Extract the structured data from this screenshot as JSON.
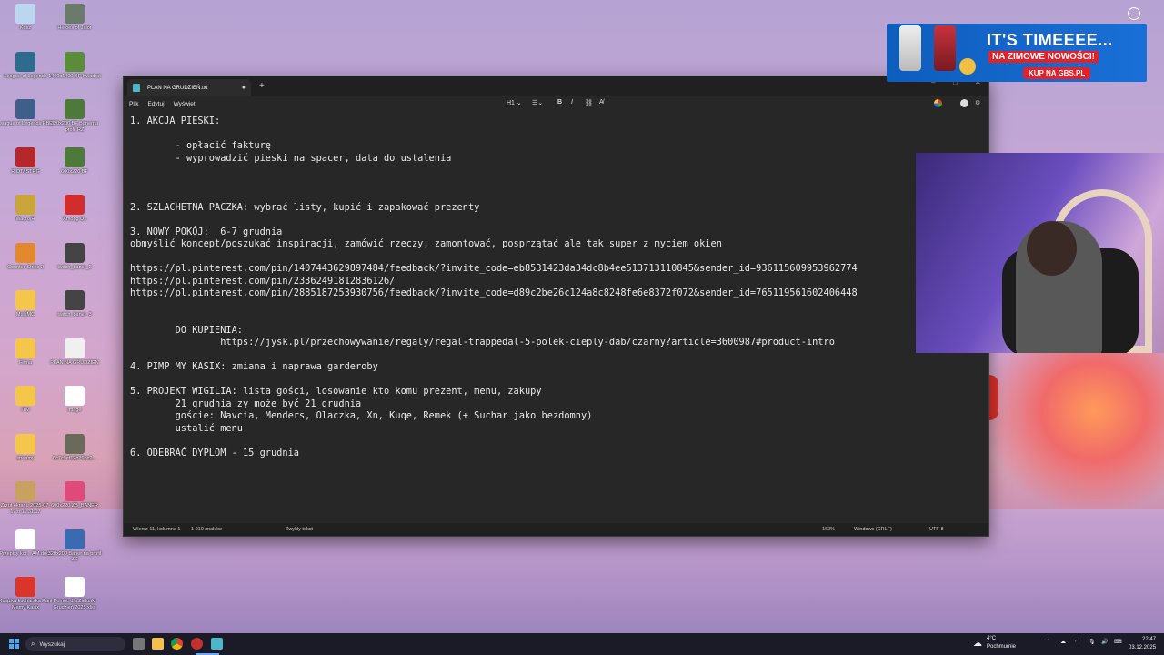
{
  "desktop": {
    "icons": [
      {
        "label": "Kosz",
        "color": "#bcd6f0"
      },
      {
        "label": "Heroes of Jalor",
        "color": "#6b7a6b"
      },
      {
        "label": "League of Legends",
        "color": "#2d6b8f"
      },
      {
        "label": "1400x1400 BF Kwadrat",
        "color": "#5a8c3a"
      },
      {
        "label": "League of Legends PBE",
        "color": "#3d5f8a"
      },
      {
        "label": "320x200 BF Banerna profil RZ",
        "color": "#4d7a3a"
      },
      {
        "label": "RIOT/ISTRG",
        "color": "#b5272a"
      },
      {
        "label": "600x220 BF",
        "color": "#4d7a3a"
      },
      {
        "label": "Macro/H",
        "color": "#c9a53a"
      },
      {
        "label": "Among Us",
        "color": "#d22d2d"
      },
      {
        "label": "Counter-Strike 2",
        "color": "#e3892b"
      },
      {
        "label": "twitch_baner_2",
        "color": "#444"
      },
      {
        "label": "MultiMC",
        "color": "#f4c74a"
      },
      {
        "label": "twitch_baner_3",
        "color": "#444"
      },
      {
        "label": "Firma",
        "color": "#f4c74a"
      },
      {
        "label": "PLAN NA GRUDZIEŃ",
        "color": "#f0f0f0"
      },
      {
        "label": "ITM",
        "color": "#f4c74a"
      },
      {
        "label": "image",
        "color": "#ffffff"
      },
      {
        "label": "streamy",
        "color": "#f4c74a"
      },
      {
        "label": "6c7c9ef12b79bc2...",
        "color": "#6a6a5a"
      },
      {
        "label": "Zrzut ekranu 2025-07-17 o 11.31.17",
        "color": "#c8a060"
      },
      {
        "label": "600x220 ZB_BANER",
        "color": "#e04a7a"
      },
      {
        "label": "Przepisy kor... AM.docx",
        "color": "#ffffff"
      },
      {
        "label": "320x200 Baner na profil ZS",
        "color": "#3a6ab0"
      },
      {
        "label": "Książka kucharska Pani Mamy Kasix",
        "color": "#d9352b"
      },
      {
        "label": "Pomoc dla Zielonki Grudzień 2025.xlsx",
        "color": "#ffffff"
      }
    ]
  },
  "notepad": {
    "tab_title": "PLAN NA GRUDZIEŃ.txt",
    "menu": [
      "Plik",
      "Edytuj",
      "Wyświetl"
    ],
    "heading_select": "H1",
    "lines": [
      "1. AKCJA PIESKI:",
      "",
      "        - opłacić fakturę",
      "        - wyprowadzić pieski na spacer, data do ustalenia",
      "",
      "",
      "",
      "2. SZLACHETNA PACZKA: wybrać listy, kupić i zapakować prezenty",
      "",
      "3. NOWY POKÓJ:  6-7 grudnia",
      "obmyślić koncept/poszukać inspiracji, zamówić rzeczy, zamontować, posprzątać ale tak super z myciem okien",
      "",
      "https://pl.pinterest.com/pin/1407443629897484/feedback/?invite_code=eb8531423da34dc8b4ee513713110845&sender_id=936115609953962774",
      "https://pl.pinterest.com/pin/23362491812836126/",
      "https://pl.pinterest.com/pin/2885187253930756/feedback/?invite_code=d89c2be26c124a8c8248fe6e8372f072&sender_id=765119561602406448",
      "",
      "",
      "        DO KUPIENIA:",
      "                https://jysk.pl/przechowywanie/regaly/regal-trappedal-5-polek-cieply-dab/czarny?article=3600987#product-intro",
      "",
      "4. PIMP MY KASIX: zmiana i naprawa garderoby",
      "",
      "5. PROJEKT WIGILIA: lista gości, losowanie kto komu prezent, menu, zakupy",
      "        21 grudnia zy może być 21 grudnia",
      "        goście: Navcia, Menders, Olaczka, Xn, Kuqe, Remek (+ Suchar jako bezdomny)",
      "        ustalić menu",
      "",
      "6. ODEBRAĆ DYPLOM - 15 grudnia"
    ],
    "status": {
      "position": "Wiersz 11, kolumna 1",
      "chars": "1 010 znaków",
      "format": "Zwykły tekst",
      "zoom": "160%",
      "line_ending": "Windows (CRLF)",
      "encoding": "UTF-8"
    }
  },
  "ad": {
    "title": "IT'S TIMEEEE...",
    "subtitle": "NA ZIMOWE NOWOŚCI!",
    "cta": "KUP NA GBS.PL"
  },
  "taskbar": {
    "search_placeholder": "Wyszukaj",
    "weather_temp": "4°C",
    "weather_desc": "Pochmurnie",
    "time": "22:47",
    "date": "03.12.2025"
  }
}
